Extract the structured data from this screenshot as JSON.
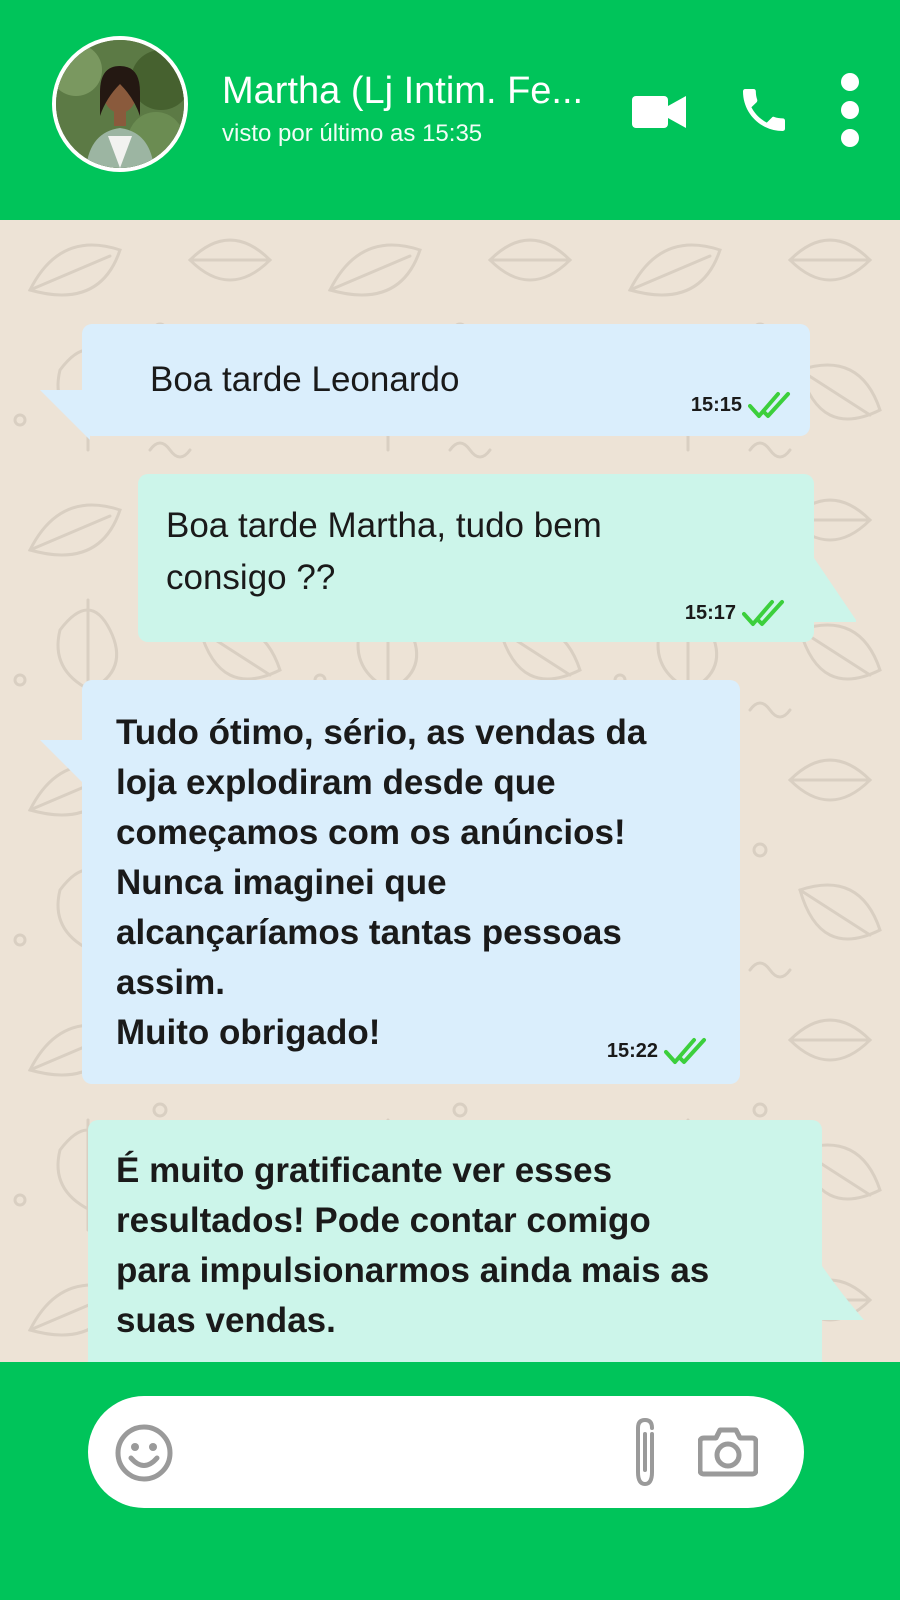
{
  "header": {
    "contact_name": "Martha (Lj Intim. Fe...",
    "last_seen": "visto por último as 15:35",
    "icons": [
      "avatar-photo",
      "video-call-icon",
      "phone-icon",
      "more-options-icon"
    ]
  },
  "messages": [
    {
      "direction": "incoming",
      "text": "Boa tarde Leonardo",
      "time": "15:15",
      "status": "read"
    },
    {
      "direction": "outgoing",
      "text": "Boa tarde Martha, tudo bem\nconsigo ??",
      "time": "15:17",
      "status": "read"
    },
    {
      "direction": "incoming",
      "text": "Tudo ótimo, sério, as vendas da\nloja explodiram desde que\ncomeçamos com os anúncios!\nNunca imaginei que\nalcançaríamos tantas pessoas\nassim.\nMuito obrigado!",
      "time": "15:22",
      "status": "read"
    },
    {
      "direction": "outgoing",
      "text": "É muito gratificante ver esses\nresultados! Pode contar comigo\npara impulsionarmos ainda mais as\nsuas vendas.",
      "time": "",
      "status": ""
    }
  ],
  "composer": {
    "value": "",
    "icons": [
      "emoji-icon",
      "attach-icon",
      "camera-icon"
    ]
  },
  "colors": {
    "header_green": "#00c45a",
    "chat_background": "#ede3d6",
    "incoming_bubble": "#daeefc",
    "outgoing_bubble": "#ccf5ea",
    "read_tick": "#3ccf3c"
  }
}
